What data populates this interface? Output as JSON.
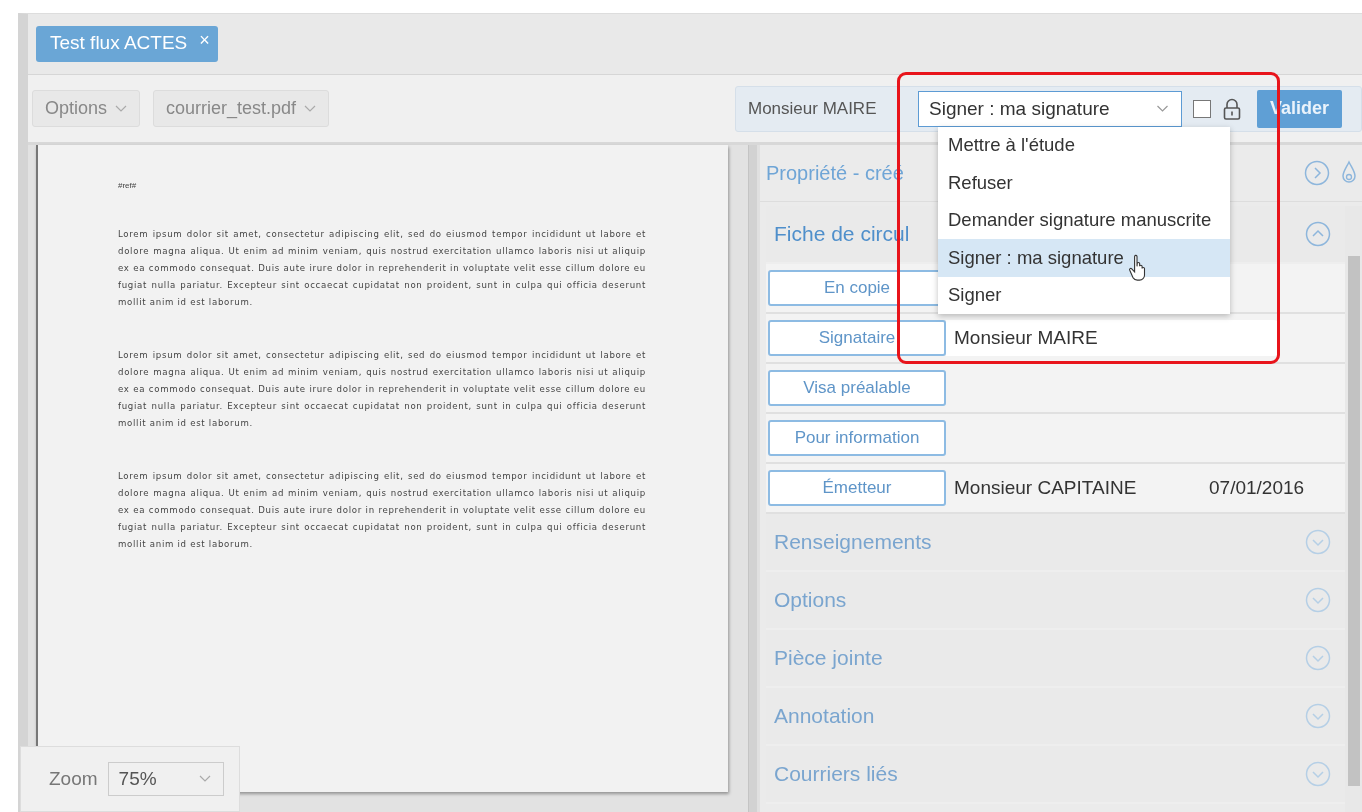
{
  "tabs": [
    {
      "label": "Test flux ACTES",
      "selected": true,
      "close": "×"
    }
  ],
  "toolbar": {
    "options_menu": "Options",
    "file_menu": "courrier_test.pdf"
  },
  "action_bar": {
    "signer": "Monsieur MAIRE",
    "action_select": {
      "value": "Signer : ma signature",
      "expanded": true,
      "options": [
        {
          "label": "Mettre à l'étude",
          "selected": false
        },
        {
          "label": "Refuser",
          "selected": false
        },
        {
          "label": "Demander signature manuscrite",
          "selected": false
        },
        {
          "label": "Signer : ma signature",
          "selected": true
        },
        {
          "label": "Signer",
          "selected": false
        }
      ]
    },
    "checkbox": {
      "checked": false
    },
    "validate_button": "Valider"
  },
  "document": {
    "reference": "#ref#",
    "paragraphs": [
      "Lorem ipsum dolor sit amet, consectetur adipiscing elit, sed do eiusmod tempor incididunt ut labore et dolore magna aliqua. Ut enim ad minim veniam, quis nostrud exercitation ullamco laboris nisi ut aliquip ex ea commodo consequat. Duis aute irure dolor in reprehenderit in voluptate velit esse cillum dolore eu fugiat nulla pariatur. Excepteur sint occaecat cupidatat non proident, sunt in culpa qui officia deserunt mollit anim id est laborum.",
      "Lorem ipsum dolor sit amet, consectetur adipiscing elit, sed do eiusmod tempor incididunt ut labore et dolore magna aliqua. Ut enim ad minim veniam, quis nostrud exercitation ullamco laboris nisi ut aliquip ex ea commodo consequat. Duis aute irure dolor in reprehenderit in voluptate velit esse cillum dolore eu fugiat nulla pariatur. Excepteur sint occaecat cupidatat non proident, sunt in culpa qui officia deserunt mollit anim id est laborum.",
      "Lorem ipsum dolor sit amet, consectetur adipiscing elit, sed do eiusmod tempor incididunt ut labore et dolore magna aliqua. Ut enim ad minim veniam, quis nostrud exercitation ullamco laboris nisi ut aliquip ex ea commodo consequat. Duis aute irure dolor in reprehenderit in voluptate velit esse cillum dolore eu fugiat nulla pariatur. Excepteur sint occaecat cupidatat non proident, sunt in culpa qui officia deserunt mollit anim id est laborum."
    ]
  },
  "zoom": {
    "label": "Zoom",
    "value": "75%"
  },
  "properties": {
    "header": "Propriété - créé",
    "circulation": {
      "title": "Fiche de circul",
      "expanded": true,
      "rows": [
        {
          "role": "En copie"
        },
        {
          "role": "Signataire",
          "person": "Monsieur MAIRE"
        },
        {
          "role": "Visa préalable"
        },
        {
          "role": "Pour information"
        },
        {
          "role": "Émetteur",
          "person": "Monsieur CAPITAINE",
          "date": "07/01/2016"
        }
      ]
    },
    "sections": [
      {
        "title": "Renseignements",
        "expanded": false
      },
      {
        "title": "Options",
        "expanded": false
      },
      {
        "title": "Pièce jointe",
        "expanded": false
      },
      {
        "title": "Annotation",
        "expanded": false
      },
      {
        "title": "Courriers liés",
        "expanded": false
      }
    ]
  }
}
